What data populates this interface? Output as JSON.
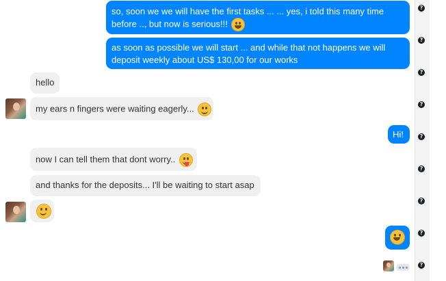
{
  "messages": {
    "m1_line1": "so, soon we we will have the first tasks ... ... yes, i told this many time",
    "m1_line2": "before .., but now is serious!!!",
    "m2_line1": "as soon as possible we will start ... and while that not happens we will",
    "m2_line2": "deposit weekly about US$ 130,00 for our works",
    "m3": "hello",
    "m4": "my ears n fingers were waiting eagerly...",
    "m5": "Hi!",
    "m6": "now I can tell them that dont worry..",
    "m7": "and thanks for the deposits... I'll be waiting to start asap"
  },
  "icons": {
    "help": "?",
    "emoji_grin": "grinning-face-emoji-icon",
    "emoji_smile": "slightly-smiling-face-emoji-icon",
    "emoji_tongue": "face-with-tongue-emoji-icon"
  },
  "colors": {
    "outgoing": "#0084ff",
    "incoming": "#f1f0f0",
    "help_icon": "#1c1e21"
  }
}
